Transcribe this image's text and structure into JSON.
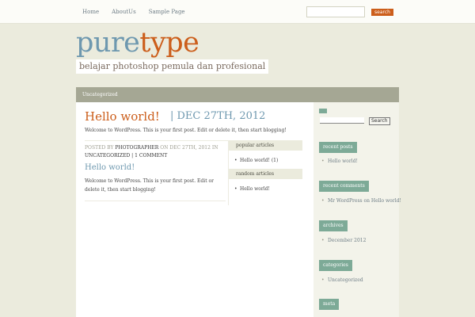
{
  "nav": {
    "items": [
      "Home",
      "AboutUs",
      "Sample Page"
    ]
  },
  "top_search": {
    "button_label": "search",
    "placeholder": ""
  },
  "header": {
    "logo_part1": "pure",
    "logo_part2": "type",
    "tagline": "belajar photoshop pemula dan profesional"
  },
  "category_bar": {
    "label": "Uncategorized"
  },
  "post": {
    "title": "Hello world!",
    "date": "| DEC 27TH, 2012",
    "excerpt": "Welcome to WordPress. This is your first post. Edit or delete it, then start blogging!"
  },
  "post_meta": {
    "posted_by": "POSTED BY",
    "author": "PHOTOGRAPHER",
    "on": "ON DEC 27TH, 2012 IN",
    "category": "UNCATEGORIZED",
    "separator": "|",
    "comments": "1 COMMENT"
  },
  "post2": {
    "title": "Hello world!",
    "body": "Welcome to WordPress. This is your first post. Edit or delete it, then start blogging!"
  },
  "inner_widgets": {
    "popular_heading": "popular articles",
    "popular_item": "Hello world! (1)",
    "random_heading": "random articles",
    "random_item": "Hello world!"
  },
  "sidebar": {
    "search_button": "Search",
    "recent_posts_heading": "recent posts",
    "recent_posts_item": "Hello world!",
    "recent_comments_heading": "recent comments",
    "recent_comments_item": "Mr WordPress on Hello world!",
    "archives_heading": "archives",
    "archives_item": "December 2012",
    "categories_heading": "categories",
    "categories_item": "Uncategorized",
    "meta_heading": "meta"
  }
}
